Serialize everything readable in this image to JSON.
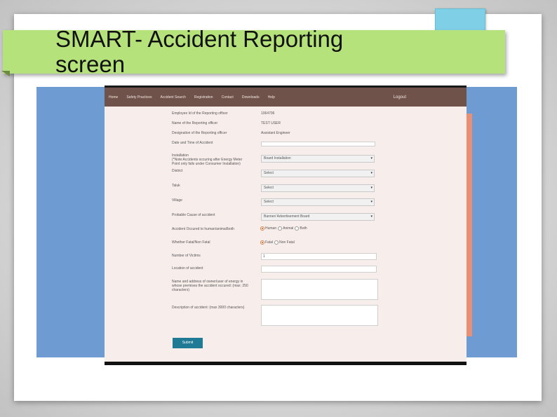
{
  "slide": {
    "title_line1": "SMART- Accident Reporting",
    "title_line2": "screen"
  },
  "nav": {
    "items": [
      "Home",
      "Safety Practices",
      "Accident Search",
      "Registration",
      "Contact",
      "Downloads",
      "Help"
    ],
    "logout": "Logout"
  },
  "form": {
    "employee_id_label": "Employee Id of the Reporting officer",
    "employee_id_value": "1064796",
    "name_label": "Name of the Reporting officer",
    "name_value": "TEST USER",
    "designation_label": "Designation of the Reporting officer",
    "designation_value": "Assistant Engineer",
    "datetime_label": "Date and Time of Accident",
    "datetime_value": "",
    "installation_label": "Installation\n(*Note:Accidents occuring after Energy Meter Point only falls under Consumer Installation)",
    "installation_value": "Board Installation",
    "district_label": "District",
    "district_value": "Select",
    "taluk_label": "Taluk",
    "taluk_value": "Select",
    "village_label": "Village",
    "village_value": "Select",
    "cause_label": "Probable Cause of accident",
    "cause_value": "Banner/ Advertisement Board",
    "occurred_label": "Accident Occured to human/animal/both",
    "occurred_options": [
      "Human",
      "Animal",
      "Both"
    ],
    "occurred_selected": "Human",
    "fatal_label": "Whether Fatal/Non Fatal",
    "fatal_options": [
      "Fatal",
      "Non Fatal"
    ],
    "fatal_selected": "Fatal",
    "victims_label": "Number of Victims",
    "victims_value": "1",
    "location_label": "Location of accident",
    "location_value": "",
    "owner_label": "Name and address of owner/user of energy in whose premises the accident occured: (max: 250 characters)",
    "description_label": "Description of accident: (max 3000 characters)",
    "submit_label": "Submit"
  },
  "colors": {
    "title_banner": "#b5e27a",
    "navbar": "#6f5249",
    "submit": "#1f7a96",
    "blue_panel": "#6f9bd3",
    "accent_scroll": "#e98f75"
  }
}
